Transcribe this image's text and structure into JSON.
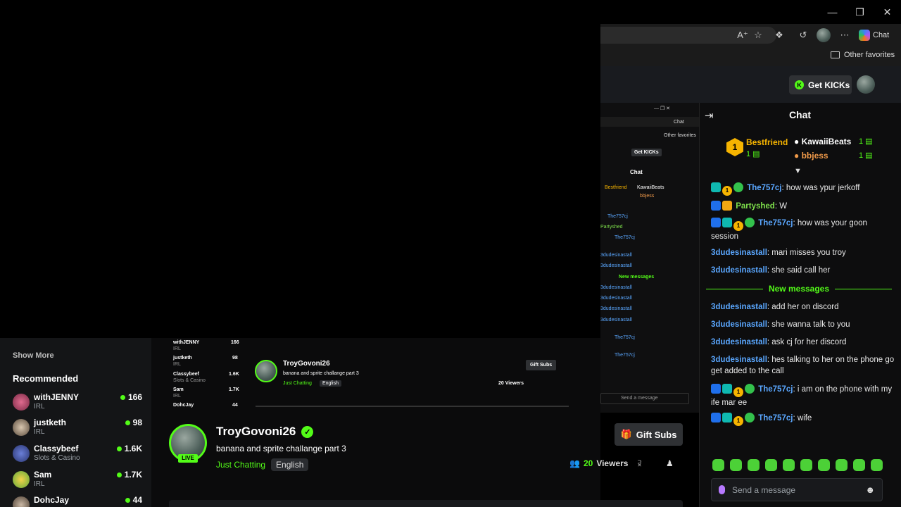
{
  "browser": {
    "chat_label": "Chat",
    "other_favorites": "Other favorites"
  },
  "header": {
    "get_kicks": "Get KICKs"
  },
  "chat": {
    "title": "Chat",
    "leaderboard": [
      {
        "rank": "1",
        "name": "Bestfriend",
        "count": "1"
      },
      {
        "name": "KawaiiBeats",
        "count": "1"
      },
      {
        "name": "bbjess",
        "count": "1"
      }
    ],
    "messages": [
      {
        "user": "The757cj",
        "text": ": how was ypur jerkoff"
      },
      {
        "user": "Partyshed",
        "text": ": W"
      },
      {
        "user": "The757cj",
        "text": ": how was your goon session"
      },
      {
        "user": "3dudesinastall",
        "text": ": mari misses you troy"
      },
      {
        "user": "3dudesinastall",
        "text": ": she said call her"
      },
      {
        "user": "3dudesinastall",
        "text": ": add her on discord"
      },
      {
        "user": "3dudesinastall",
        "text": ": she wanna talk to you"
      },
      {
        "user": "3dudesinastall",
        "text": ": ask cj for her discord"
      },
      {
        "user": "3dudesinastall",
        "text": ": hes talking to her on the phone go get added to the call"
      },
      {
        "user": "The757cj",
        "text": ": i am on the phone with my ife mar ee"
      },
      {
        "user": "The757cj",
        "text": ": wife"
      }
    ],
    "new_messages": "New messages",
    "gift_badge": "1",
    "send_placeholder": "Send a message"
  },
  "sidebar": {
    "show_more": "Show More",
    "recommended": "Recommended",
    "channels": [
      {
        "name": "withJENNY",
        "category": "IRL",
        "viewers": "166"
      },
      {
        "name": "justketh",
        "category": "IRL",
        "viewers": "98"
      },
      {
        "name": "Classybeef",
        "category": "Slots & Casino",
        "viewers": "1.6K"
      },
      {
        "name": "Sam",
        "category": "IRL",
        "viewers": "1.7K"
      },
      {
        "name": "DohcJay",
        "category": "",
        "viewers": "44"
      }
    ]
  },
  "stream": {
    "live": "LIVE",
    "streamer": "TroyGovoni26",
    "title": "banana and sprite challange part 3",
    "category": "Just Chatting",
    "language": "English",
    "viewers_count": "20",
    "viewers_label": "Viewers",
    "gift_subs": "Gift Subs"
  },
  "inner": {
    "channels": [
      {
        "name": "withJENNY",
        "category": "IRL",
        "viewers": "166"
      },
      {
        "name": "justketh",
        "category": "IRL",
        "viewers": "98"
      },
      {
        "name": "Classybeef",
        "category": "Slots & Casino",
        "viewers": "1.6K"
      },
      {
        "name": "Sam",
        "category": "IRL",
        "viewers": "1.7K"
      },
      {
        "name": "DohcJay",
        "category": "",
        "viewers": "44"
      }
    ],
    "streamer": "TroyGovoni26",
    "title": "banana and sprite challange part 3",
    "category": "Just Chatting",
    "language": "English",
    "viewers": "20 Viewers",
    "gift_subs": "Gift Subs",
    "send": "Send a message",
    "chat": "Chat",
    "get_kicks": "Get KICKs",
    "other_favorites": "Other favorites",
    "new_messages": "New messages"
  }
}
